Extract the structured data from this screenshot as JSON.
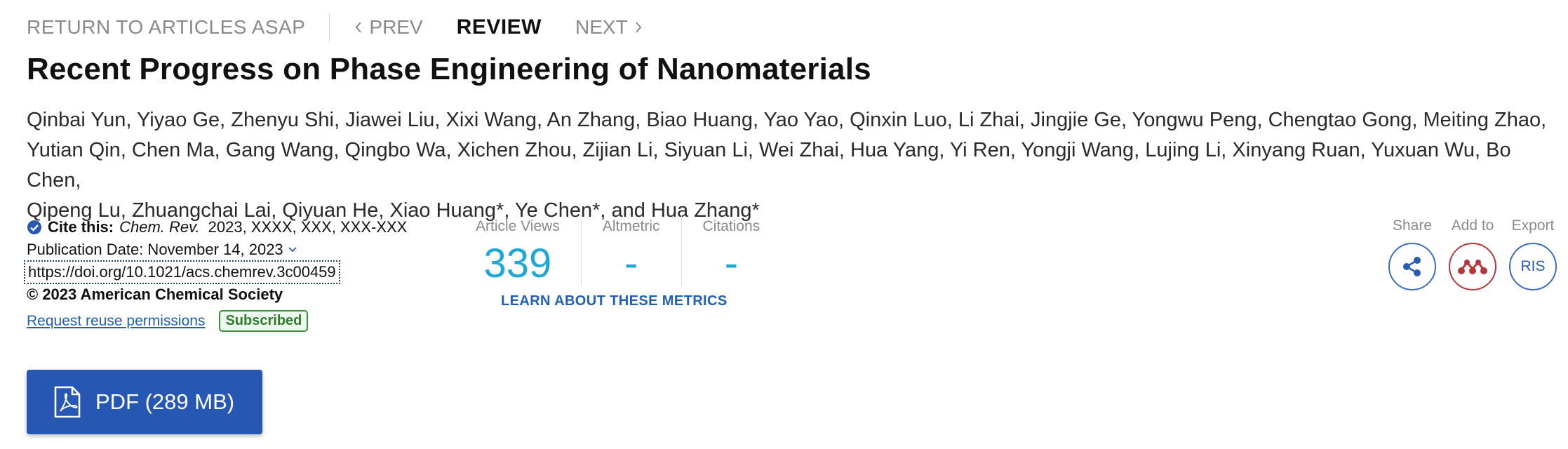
{
  "nav": {
    "return_label": "RETURN TO ARTICLES ASAP",
    "prev_label": "PREV",
    "review_label": "REVIEW",
    "next_label": "NEXT"
  },
  "article": {
    "title": "Recent Progress on Phase Engineering of Nanomaterials",
    "authors_line1": "Qinbai Yun, Yiyao Ge, Zhenyu Shi, Jiawei Liu, Xixi Wang, An Zhang, Biao Huang, Yao Yao, Qinxin Luo, Li Zhai, Jingjie Ge, Yongwu Peng, Chengtao Gong, Meiting Zhao,",
    "authors_line2": "Yutian Qin, Chen Ma, Gang Wang, Qingbo Wa, Xichen Zhou, Zijian Li, Siyuan Li, Wei Zhai, Hua Yang, Yi Ren, Yongji Wang, Lujing Li, Xinyang Ruan, Yuxuan Wu, Bo Chen,",
    "authors_line3": "Qipeng Lu, Zhuangchai Lai, Qiyuan He, Xiao Huang*, Ye Chen*, and Hua Zhang*"
  },
  "cite": {
    "label": "Cite this:",
    "journal": "Chem. Rev.",
    "reference": "2023, XXXX, XXX, XXX-XXX",
    "publication_date": "Publication Date: November 14, 2023",
    "doi": "https://doi.org/10.1021/acs.chemrev.3c00459",
    "copyright": "© 2023 American Chemical Society",
    "reuse_link": "Request reuse permissions",
    "access_badge": "Subscribed"
  },
  "metrics": {
    "views_label": "Article Views",
    "views_value": "339",
    "altmetric_label": "Altmetric",
    "altmetric_value": "-",
    "citations_label": "Citations",
    "citations_value": "-",
    "learn_link": "LEARN ABOUT THESE METRICS"
  },
  "actions": {
    "share_label": "Share",
    "add_label": "Add to",
    "export_label": "Export",
    "ris_label": "RIS"
  },
  "pdf": {
    "label": "PDF (289 MB)"
  },
  "colors": {
    "accent_blue": "#2657b2",
    "metric_blue": "#1fa7d8",
    "mendeley_red": "#b3373b",
    "subscribed_green": "#2d7d2d"
  },
  "icons": {
    "share": "share-icon",
    "mendeley": "mendeley-icon",
    "pdf": "pdf-file-icon",
    "check": "check-circle-icon"
  }
}
